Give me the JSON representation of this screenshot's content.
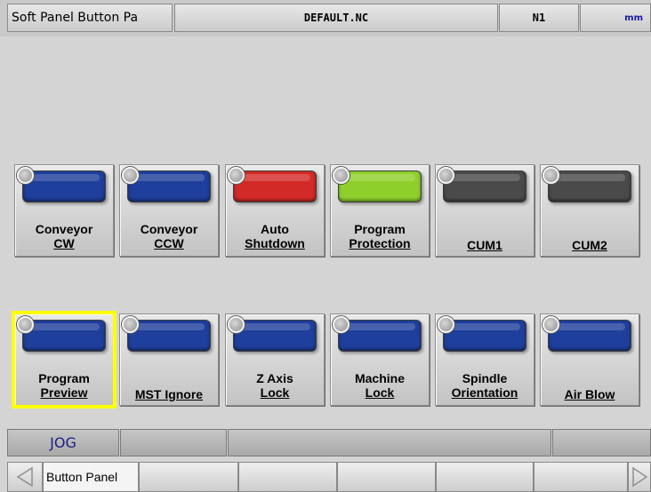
{
  "header": {
    "title": "Soft Panel  Button Pa",
    "file": "DEFAULT.NC",
    "sequence": "N1",
    "unit": "mm"
  },
  "panel": {
    "row1": [
      {
        "lines": [
          "Conveyor",
          "CW"
        ],
        "lamp_color": "#1f3f9c"
      },
      {
        "lines": [
          "Conveyor",
          "CCW"
        ],
        "lamp_color": "#1f3f9c"
      },
      {
        "lines": [
          "Auto",
          "Shutdown"
        ],
        "lamp_color": "#d22a26"
      },
      {
        "lines": [
          "Program",
          "Protection"
        ],
        "lamp_color": "#8fcf2c"
      },
      {
        "lines": [
          "CUM1"
        ],
        "lamp_color": "#4a4a4a"
      },
      {
        "lines": [
          "CUM2"
        ],
        "lamp_color": "#4a4a4a"
      }
    ],
    "row2": [
      {
        "lines": [
          "Program",
          "Preview"
        ],
        "lamp_color": "#1f3f9c"
      },
      {
        "lines": [
          "MST Ignore"
        ],
        "lamp_color": "#1f3f9c"
      },
      {
        "lines": [
          "Z Axis",
          "Lock"
        ],
        "lamp_color": "#1f3f9c"
      },
      {
        "lines": [
          "Machine",
          "Lock"
        ],
        "lamp_color": "#1f3f9c"
      },
      {
        "lines": [
          "Spindle",
          "Orientation"
        ],
        "lamp_color": "#1f3f9c"
      },
      {
        "lines": [
          "Air Blow"
        ],
        "lamp_color": "#1f3f9c"
      }
    ],
    "selected_highlight_color": "#ffff00"
  },
  "status": {
    "mode": "JOG",
    "field2": "",
    "field3": "",
    "field4": ""
  },
  "softkeys": {
    "prev_icon": "left-triangle-icon",
    "next_icon": "right-triangle-icon",
    "active_label": "Button Panel",
    "empty_keys": [
      "",
      "",
      "",
      "",
      "",
      ""
    ]
  }
}
